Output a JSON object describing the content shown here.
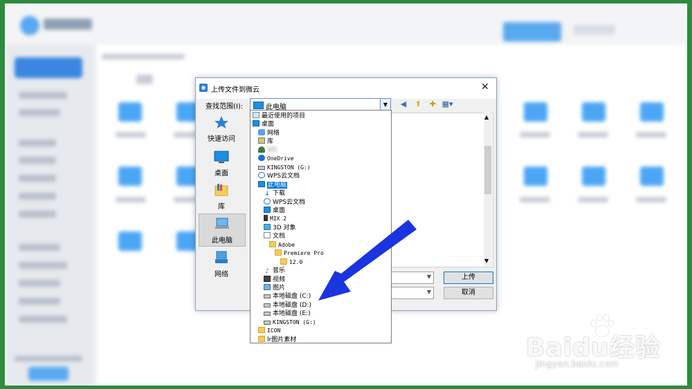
{
  "dialog": {
    "title": "上传文件到微云",
    "lookin_label": "查找范围(I):",
    "lookin_value": "此电脑",
    "upload_button": "上传",
    "cancel_button": "取消"
  },
  "places": [
    {
      "label": "快速访问",
      "icon": "star-icon"
    },
    {
      "label": "桌面",
      "icon": "desktop-icon"
    },
    {
      "label": "库",
      "icon": "library-icon"
    },
    {
      "label": "此电脑",
      "icon": "computer-icon",
      "selected": true
    },
    {
      "label": "网络",
      "icon": "network-icon"
    }
  ],
  "dropdown": {
    "items": [
      {
        "label": "最近使用的项目",
        "icon": "recent",
        "indent": 0
      },
      {
        "label": "桌面",
        "icon": "desk",
        "indent": 0
      },
      {
        "label": "网络",
        "icon": "net",
        "indent": 1
      },
      {
        "label": "库",
        "icon": "lib",
        "indent": 1
      },
      {
        "label": "",
        "icon": "user",
        "indent": 1
      },
      {
        "label": "OneDrive",
        "icon": "od",
        "indent": 1
      },
      {
        "label": "KINGSTON (G:)",
        "icon": "drive",
        "indent": 1
      },
      {
        "label": "WPS云文档",
        "icon": "cloud",
        "indent": 1
      },
      {
        "label": "此电脑",
        "icon": "desk",
        "indent": 1,
        "highlighted": true
      },
      {
        "label": "下载",
        "icon": "dl",
        "indent": 2
      },
      {
        "label": "WPS云文档",
        "icon": "cloud",
        "indent": 2
      },
      {
        "label": "桌面",
        "icon": "desk",
        "indent": 2
      },
      {
        "label": "MIX 2",
        "icon": "phone",
        "indent": 2
      },
      {
        "label": "3D 对象",
        "icon": "cube",
        "indent": 2
      },
      {
        "label": "文档",
        "icon": "doc",
        "indent": 2
      },
      {
        "label": "Adobe",
        "icon": "fold",
        "indent": 3
      },
      {
        "label": "Premiere Pro",
        "icon": "fold",
        "indent": 4
      },
      {
        "label": "12.0",
        "icon": "fold",
        "indent": 5
      },
      {
        "label": "音乐",
        "icon": "music",
        "indent": 2
      },
      {
        "label": "视频",
        "icon": "video",
        "indent": 2
      },
      {
        "label": "图片",
        "icon": "pic",
        "indent": 2
      },
      {
        "label": "本地磁盘 (C:)",
        "icon": "drive",
        "indent": 2
      },
      {
        "label": "本地磁盘 (D:)",
        "icon": "drive",
        "indent": 2
      },
      {
        "label": "本地磁盘 (E:)",
        "icon": "drive",
        "indent": 2
      },
      {
        "label": "KINGSTON (G:)",
        "icon": "drive",
        "indent": 2
      },
      {
        "label": "ICON",
        "icon": "fold",
        "indent": 1
      },
      {
        "label": "lr图片素材",
        "icon": "fold",
        "indent": 1
      }
    ]
  },
  "watermark": {
    "brand": "Baidu经验",
    "url": "jingyan.baidu.com"
  },
  "colors": {
    "accent": "#0078d7",
    "annotation_arrow": "#1a35e0",
    "frame": "#2e8b3e"
  }
}
